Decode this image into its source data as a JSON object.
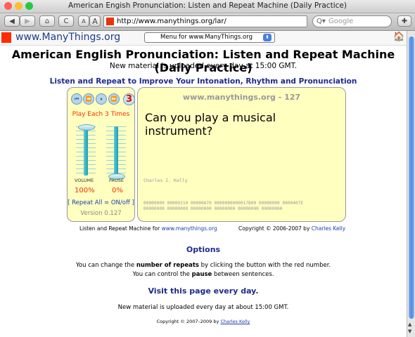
{
  "window": {
    "title": "American Engish Pronunciation: Listen and Repeat Machine (Daily Practice)",
    "colors": {
      "close": "#ff5f57",
      "minimize": "#febc2e",
      "zoom": "#28c840"
    }
  },
  "toolbar": {
    "back": "◀",
    "forward": "▶",
    "home_icon": "home-icon",
    "reload_icon": "reload-icon",
    "text_smaller": "A",
    "text_larger": "A",
    "url": "http://www.manythings.org/lar/",
    "search_placeholder": "Google",
    "search_glyph": "Q▾"
  },
  "site_bar": {
    "name": "www.ManyThings.org",
    "menu_label": "Menu for www.ManyThings.org",
    "home_glyph": "🏠"
  },
  "page": {
    "title": "American English Pronunciation: Listen and Repeat Machine (Daily Practice)",
    "subtitle": "New material is uploaded every day at 15:00 GMT.",
    "heading": "Listen and Repeat to Improve Your Intonation, Rhythm and Pronunciation"
  },
  "player": {
    "buttons": [
      "⏮",
      "⏪",
      "⏸",
      "⏩"
    ],
    "repeat_count": "3",
    "play_each": "Play Each 3 Times",
    "volume_label": "VOLUME",
    "pause_label": "PAUSE",
    "volume_value": "100%",
    "pause_value": "0%",
    "volume_level": 1.0,
    "pause_level": 0.0,
    "repeat_all": "[ Repeat All = ON/off ]",
    "version": "Version 0.127"
  },
  "sentence_panel": {
    "site_number": "www.manythings.org - 127",
    "sentence": "Can you play a musical instrument?",
    "author": "Charles I. Kelly",
    "hex_line1": "00000000 00000210 00000A70 0000000000017B00 00000000 0000407E",
    "hex_line2": "00000000 00000000 00000000 00000000 00000000 00000000"
  },
  "credits": {
    "left_text": "Listen and Repeat Machine for ",
    "left_link": "www.manythings.org",
    "right_text": "Copyright © 2006-2007 by ",
    "right_link": "Charles Kelly"
  },
  "options": {
    "title": "Options",
    "line1_pre": "You can change the ",
    "line1_bold": "number of repeats",
    "line1_post": " by clicking the button with the red number.",
    "line2_pre": "You can control the ",
    "line2_bold": "pause",
    "line2_post": " between sentences."
  },
  "footer": {
    "visit": "Visit this page every day.",
    "note": "New material is uploaded every day at about 15:00 GMT.",
    "copyright_text": "Copyright © 2007–2009 by ",
    "copyright_link": "Charles Kelly"
  }
}
